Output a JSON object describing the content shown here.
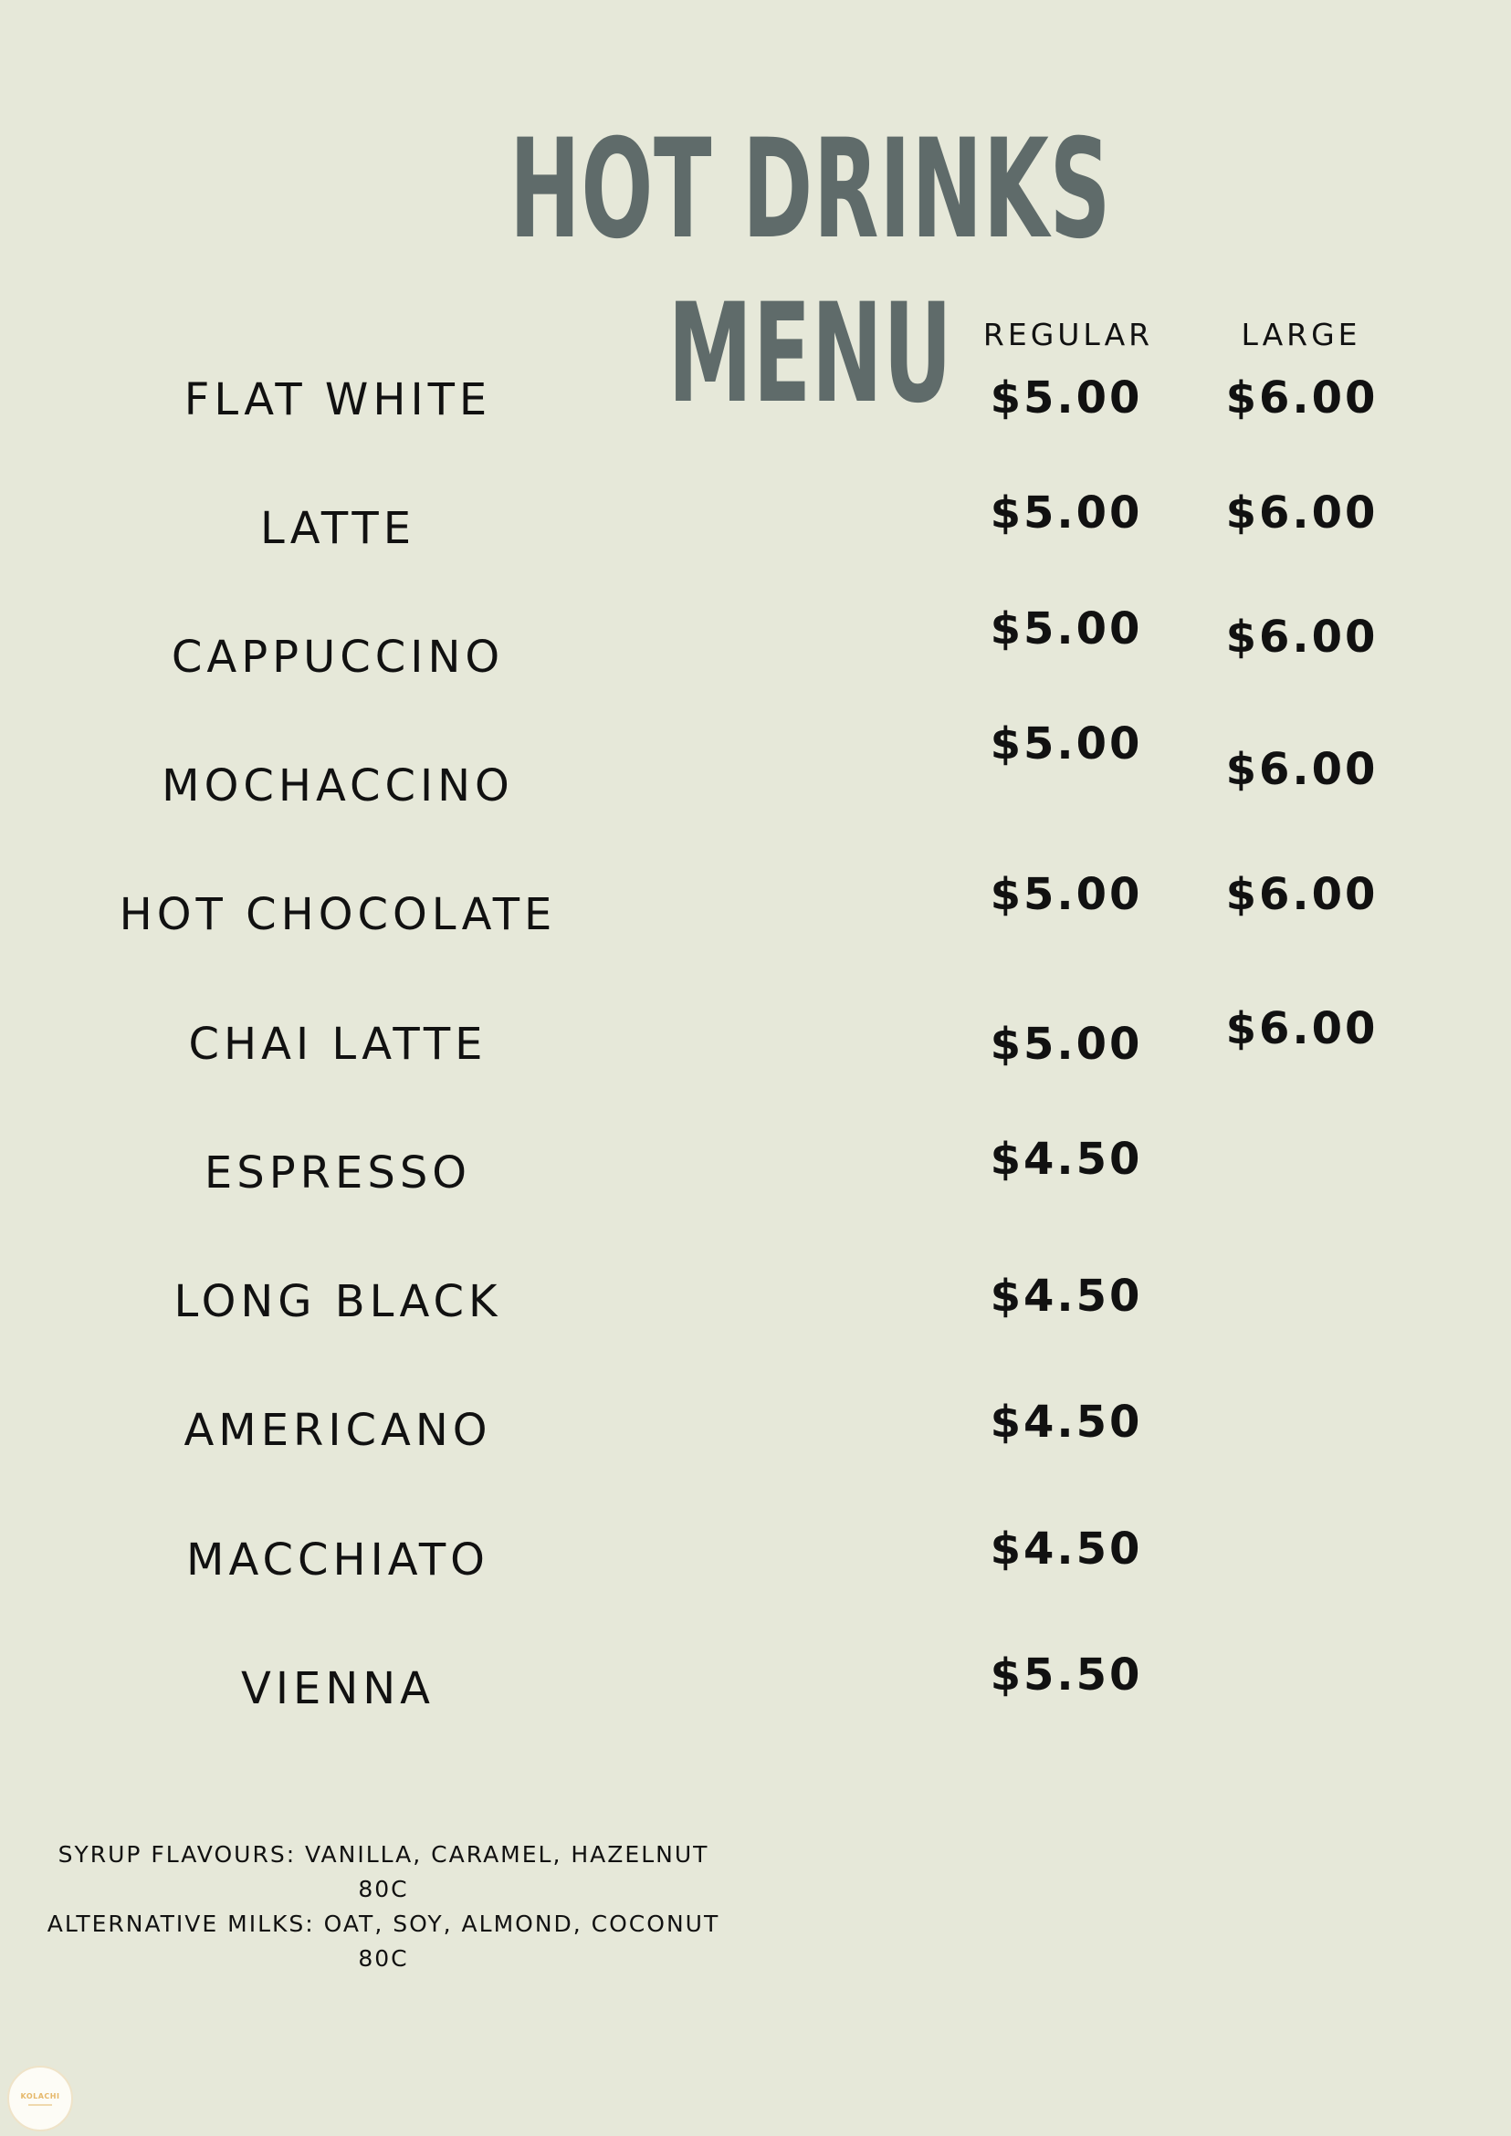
{
  "title": "HOT DRINKS MENU",
  "columns": {
    "regular": "REGULAR",
    "large": "LARGE"
  },
  "items": [
    {
      "name": "FLAT WHITE",
      "regular": "$5.00",
      "large": "$6.00"
    },
    {
      "name": "LATTE",
      "regular": "$5.00",
      "large": "$6.00"
    },
    {
      "name": "CAPPUCCINO",
      "regular": "$5.00",
      "large": "$6.00"
    },
    {
      "name": "MOCHACCINO",
      "regular": "$5.00",
      "large": "$6.00"
    },
    {
      "name": "HOT CHOCOLATE",
      "regular": "$5.00",
      "large": "$6.00"
    },
    {
      "name": "CHAI LATTE",
      "regular": "$5.00",
      "large": "$6.00"
    },
    {
      "name": "ESPRESSO",
      "regular": "$4.50"
    },
    {
      "name": "LONG BLACK",
      "regular": "$4.50"
    },
    {
      "name": "AMERICANO",
      "regular": "$4.50"
    },
    {
      "name": "MACCHIATO",
      "regular": "$4.50"
    },
    {
      "name": "VIENNA",
      "regular": "$5.50"
    }
  ],
  "footer": {
    "syrup_line": "SYRUP FLAVOURS: VANILLA, CARAMEL, HAZELNUT",
    "syrup_price": "80C",
    "milk_line": "ALTERNATIVE MILKS: OAT, SOY, ALMOND, COCONUT",
    "milk_price": "80C"
  },
  "logo": {
    "text": "KOLACHI",
    "color": "#e6b86a"
  },
  "colors": {
    "background": "#e6e8d9",
    "title": "#5f6b6a",
    "text": "#111111"
  }
}
